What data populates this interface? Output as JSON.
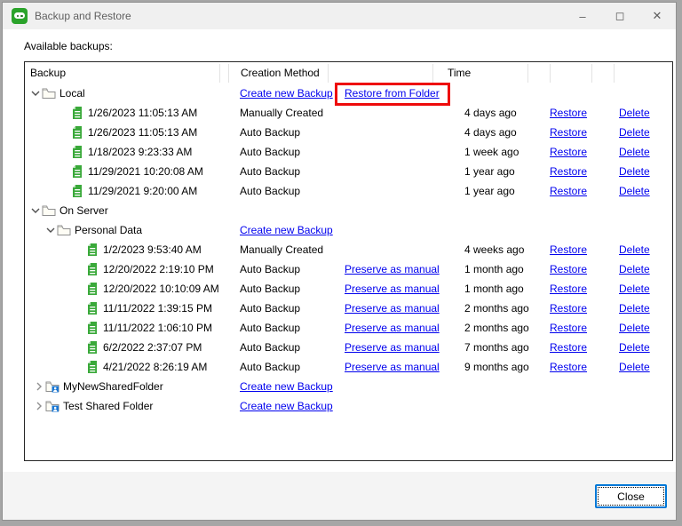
{
  "window": {
    "title": "Backup and Restore",
    "controls": {
      "minimize": "–",
      "maximize": "◻",
      "close": "✕"
    }
  },
  "labels": {
    "available_backups": "Available backups:",
    "close_button": "Close"
  },
  "colors": {
    "accent_blue": "#0078d7",
    "link_blue": "#0000ee",
    "annotation_red": "#ee0a0a",
    "brand_green": "#2ba32b",
    "backup_icon_green": "#3aa93a",
    "shared_badge_blue": "#1976d2"
  },
  "table": {
    "headers": {
      "backup": "Backup",
      "creation_method": "Creation Method",
      "time": "Time"
    },
    "link_labels": {
      "restore": "Restore",
      "delete": "Delete"
    },
    "rows": [
      {
        "type": "folder",
        "level": 0,
        "chevron": "down",
        "icon": "folder",
        "label": "Local",
        "method_link": "Create new Backup",
        "action_link": "Restore from Folder",
        "annotated": true,
        "method": "",
        "time": "",
        "restore": false,
        "delete": false
      },
      {
        "type": "backup",
        "level": 1,
        "chevron": "",
        "icon": "backup",
        "label": "1/26/2023 11:05:13 AM",
        "method": "Manually Created",
        "method_link": "",
        "action_link": "",
        "annotated": false,
        "time": "4 days ago",
        "restore": true,
        "delete": true
      },
      {
        "type": "backup",
        "level": 1,
        "chevron": "",
        "icon": "backup",
        "label": "1/26/2023 11:05:13 AM",
        "method": "Auto Backup",
        "method_link": "",
        "action_link": "",
        "annotated": false,
        "time": "4 days ago",
        "restore": true,
        "delete": true
      },
      {
        "type": "backup",
        "level": 1,
        "chevron": "",
        "icon": "backup",
        "label": "1/18/2023 9:23:33 AM",
        "method": "Auto Backup",
        "method_link": "",
        "action_link": "",
        "annotated": false,
        "time": "1 week ago",
        "restore": true,
        "delete": true
      },
      {
        "type": "backup",
        "level": 1,
        "chevron": "",
        "icon": "backup",
        "label": "11/29/2021 10:20:08 AM",
        "method": "Auto Backup",
        "method_link": "",
        "action_link": "",
        "annotated": false,
        "time": "1 year ago",
        "restore": true,
        "delete": true
      },
      {
        "type": "backup",
        "level": 1,
        "chevron": "",
        "icon": "backup",
        "label": "11/29/2021 9:20:00 AM",
        "method": "Auto Backup",
        "method_link": "",
        "action_link": "",
        "annotated": false,
        "time": "1 year ago",
        "restore": true,
        "delete": true
      },
      {
        "type": "folder",
        "level": 0,
        "chevron": "down",
        "icon": "folder",
        "label": "On Server",
        "method": "",
        "method_link": "",
        "action_link": "",
        "annotated": false,
        "time": "",
        "restore": false,
        "delete": false
      },
      {
        "type": "folder",
        "level": 1,
        "chevron": "down",
        "icon": "folder",
        "label": "Personal Data",
        "method": "",
        "method_link": "Create new Backup",
        "action_link": "",
        "annotated": false,
        "time": "",
        "restore": false,
        "delete": false
      },
      {
        "type": "backup",
        "level": 2,
        "chevron": "",
        "icon": "backup",
        "label": "1/2/2023 9:53:40 AM",
        "method": "Manually Created",
        "method_link": "",
        "action_link": "",
        "annotated": false,
        "time": "4 weeks ago",
        "restore": true,
        "delete": true
      },
      {
        "type": "backup",
        "level": 2,
        "chevron": "",
        "icon": "backup",
        "label": "12/20/2022 2:19:10 PM",
        "method": "Auto Backup",
        "method_link": "",
        "action_link": "Preserve as manual",
        "annotated": false,
        "time": "1 month ago",
        "restore": true,
        "delete": true
      },
      {
        "type": "backup",
        "level": 2,
        "chevron": "",
        "icon": "backup",
        "label": "12/20/2022 10:10:09 AM",
        "method": "Auto Backup",
        "method_link": "",
        "action_link": "Preserve as manual",
        "annotated": false,
        "time": "1 month ago",
        "restore": true,
        "delete": true
      },
      {
        "type": "backup",
        "level": 2,
        "chevron": "",
        "icon": "backup",
        "label": "11/11/2022 1:39:15 PM",
        "method": "Auto Backup",
        "method_link": "",
        "action_link": "Preserve as manual",
        "annotated": false,
        "time": "2 months ago",
        "restore": true,
        "delete": true
      },
      {
        "type": "backup",
        "level": 2,
        "chevron": "",
        "icon": "backup",
        "label": "11/11/2022 1:06:10 PM",
        "method": "Auto Backup",
        "method_link": "",
        "action_link": "Preserve as manual",
        "annotated": false,
        "time": "2 months ago",
        "restore": true,
        "delete": true
      },
      {
        "type": "backup",
        "level": 2,
        "chevron": "",
        "icon": "backup",
        "label": "6/2/2022 2:37:07 PM",
        "method": "Auto Backup",
        "method_link": "",
        "action_link": "Preserve as manual",
        "annotated": false,
        "time": "7 months ago",
        "restore": true,
        "delete": true
      },
      {
        "type": "backup",
        "level": 2,
        "chevron": "",
        "icon": "backup",
        "label": "4/21/2022 8:26:19 AM",
        "method": "Auto Backup",
        "method_link": "",
        "action_link": "Preserve as manual",
        "annotated": false,
        "time": "9 months ago",
        "restore": true,
        "delete": true
      },
      {
        "type": "shared",
        "level": 0,
        "chevron": "right",
        "icon": "shared-folder",
        "label": "MyNewSharedFolder",
        "method": "",
        "method_link": "Create new Backup",
        "action_link": "",
        "annotated": false,
        "time": "",
        "restore": false,
        "delete": false
      },
      {
        "type": "shared",
        "level": 0,
        "chevron": "right",
        "icon": "shared-folder",
        "label": "Test Shared Folder",
        "method": "",
        "method_link": "Create new Backup",
        "action_link": "",
        "annotated": false,
        "time": "",
        "restore": false,
        "delete": false
      }
    ]
  }
}
